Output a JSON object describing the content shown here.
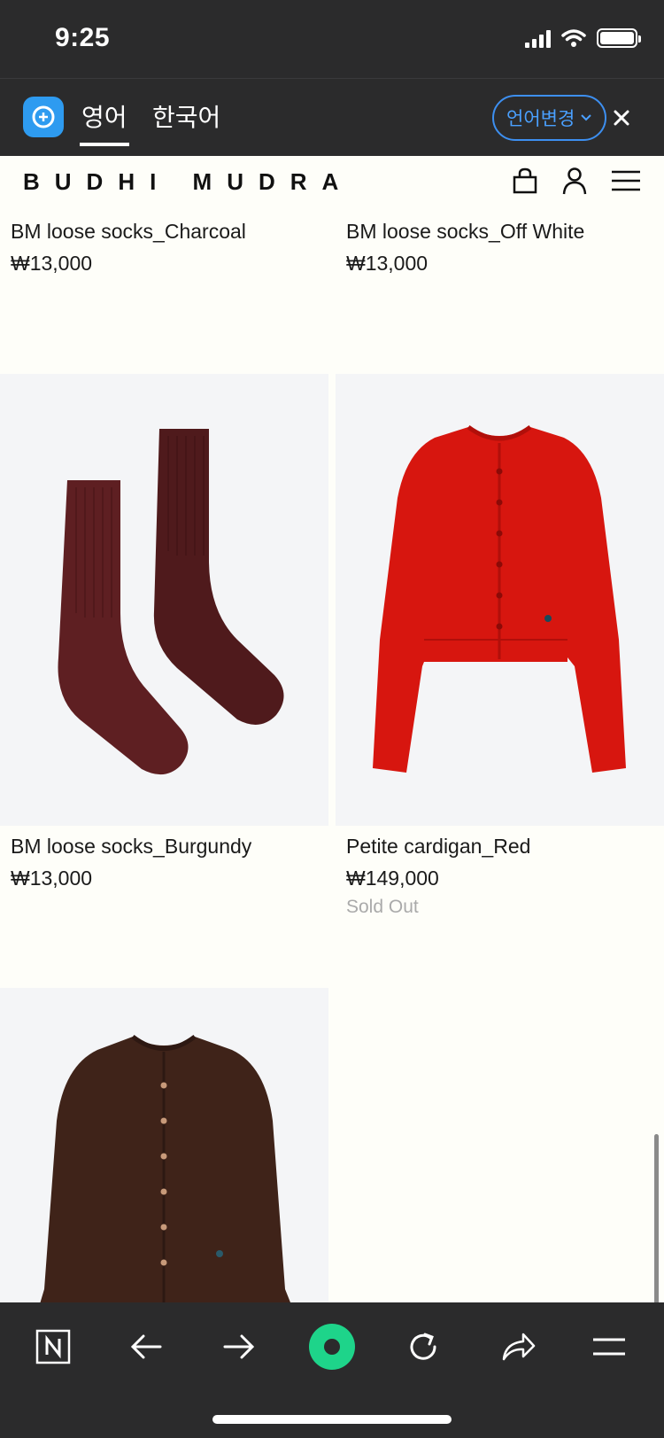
{
  "status_bar": {
    "time": "9:25"
  },
  "translate_bar": {
    "active_language": "영어",
    "other_language": "한국어",
    "change_language_label": "언어변경"
  },
  "site": {
    "brand": "BUDHI MUDRA"
  },
  "products": [
    {
      "name": "BM loose socks_Charcoal",
      "price": "₩13,000"
    },
    {
      "name": "BM loose socks_Off White",
      "price": "₩13,000"
    },
    {
      "name": "BM loose socks_Burgundy",
      "price": "₩13,000"
    },
    {
      "name": "Petite cardigan_Red",
      "price": "₩149,000",
      "status": "Sold Out"
    },
    {
      "name": "",
      "price": ""
    }
  ],
  "colors": {
    "chrome_dark": "#2b2b2c",
    "accent_blue": "#3d8ff0",
    "page_bg": "#fefef9",
    "burgundy": "#5a1e20",
    "red": "#d7160f",
    "brown": "#3f2319",
    "green_button": "#1ed48a"
  },
  "icons": [
    "translate-logo-icon",
    "chevron-down-icon",
    "close-icon",
    "bag-icon",
    "user-icon",
    "menu-icon",
    "n-icon",
    "back-arrow-icon",
    "forward-arrow-icon",
    "green-dot-icon",
    "refresh-icon",
    "share-icon",
    "hamburger-icon"
  ]
}
